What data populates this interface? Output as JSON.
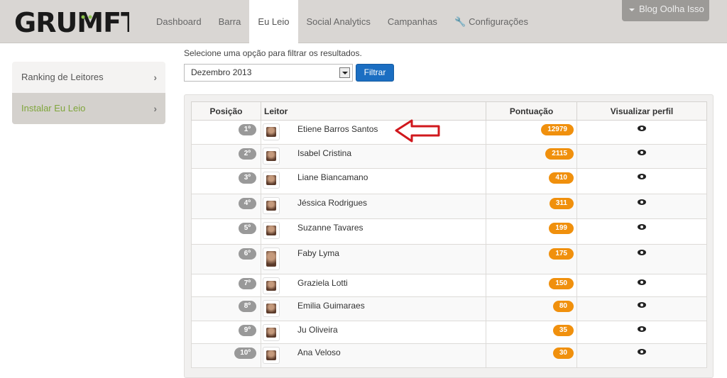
{
  "brand": {
    "logo_text": "GRUMFT"
  },
  "nav": {
    "items": [
      "Dashboard",
      "Barra",
      "Eu Leio",
      "Social Analytics",
      "Campanhas",
      "Configurações"
    ],
    "active": "Eu Leio"
  },
  "blog_menu": {
    "label": "Blog Oolha Isso"
  },
  "sidebar": {
    "items": [
      {
        "label": "Ranking de Leitores"
      },
      {
        "label": "Instalar Eu Leio"
      }
    ]
  },
  "filter": {
    "label": "Selecione uma opção para filtrar os resultados.",
    "selected": "Dezembro 2013",
    "button": "Filtrar"
  },
  "table": {
    "headers": [
      "Posição",
      "Leitor",
      "Pontuação",
      "Visualizar perfil"
    ],
    "rows": [
      {
        "pos": "1º",
        "name": "Etiene Barros Santos",
        "score": "12979"
      },
      {
        "pos": "2º",
        "name": "Isabel Cristina",
        "score": "2115"
      },
      {
        "pos": "3º",
        "name": "Liane Biancamano",
        "score": "410"
      },
      {
        "pos": "4º",
        "name": "Jéssica Rodrigues",
        "score": "311"
      },
      {
        "pos": "5º",
        "name": "Suzanne Tavares",
        "score": "199"
      },
      {
        "pos": "6º",
        "name": "Faby Lyma",
        "score": "175"
      },
      {
        "pos": "7º",
        "name": "Graziela Lotti",
        "score": "150"
      },
      {
        "pos": "8º",
        "name": "Emilia Guimaraes",
        "score": "80"
      },
      {
        "pos": "9º",
        "name": "Ju Oliveira",
        "score": "35"
      },
      {
        "pos": "10º",
        "name": "Ana Veloso",
        "score": "30"
      }
    ]
  },
  "colors": {
    "accent": "#1b6ec2",
    "score_badge": "#f0900d",
    "position_badge": "#999999",
    "sidebar_active_text": "#7fa53b",
    "annotation_arrow": "#d0181d"
  }
}
